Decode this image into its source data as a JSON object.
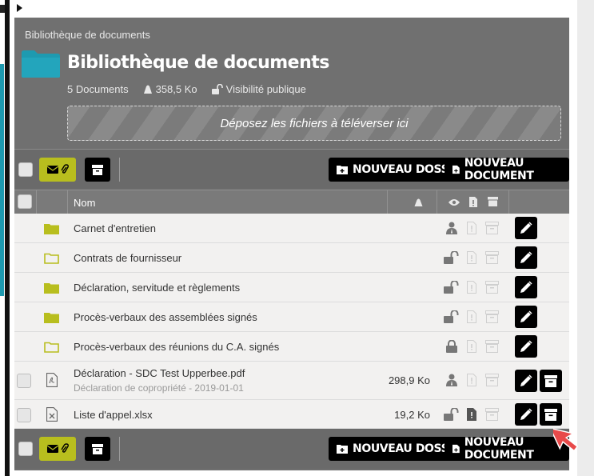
{
  "breadcrumb": "Bibliothèque de documents",
  "title": "Bibliothèque de documents",
  "meta": {
    "documents": "5 Documents",
    "size": "358,5 Ko",
    "visibility": "Visibilité publique"
  },
  "dropzone": "Déposez les fichiers à téléverser ici",
  "toolbar": {
    "new_folder": "NOUVEAU DOSSIER",
    "new_document": "NOUVEAU DOCUMENT"
  },
  "table": {
    "col_name": "Nom"
  },
  "rows": [
    {
      "name": "Carnet d'entretien",
      "kind": "folder-filled",
      "access": "person-icon"
    },
    {
      "name": "Contrats de fournisseur",
      "kind": "folder-outline",
      "access": "unlock-icon"
    },
    {
      "name": "Déclaration, servitude et règlements",
      "kind": "folder-filled",
      "access": "unlock-icon"
    },
    {
      "name": "Procès-verbaux des assemblées signés",
      "kind": "folder-filled",
      "access": "unlock-icon"
    },
    {
      "name": "Procès-verbaux des réunions du C.A. signés",
      "kind": "folder-outline",
      "access": "lock-icon"
    },
    {
      "name": "Déclaration - SDC Test Upperbee.pdf",
      "sub": "Déclaration de copropriété - 2019-01-01",
      "size": "298,9 Ko",
      "kind": "pdf",
      "access": "person-icon"
    },
    {
      "name": "Liste d'appel.xlsx",
      "size": "19,2 Ko",
      "kind": "xlsx",
      "access": "unlock-icon"
    }
  ],
  "colors": {
    "accent": "#b8be1e",
    "teal": "#1e9ab0",
    "panel": "#6f6f6f"
  }
}
